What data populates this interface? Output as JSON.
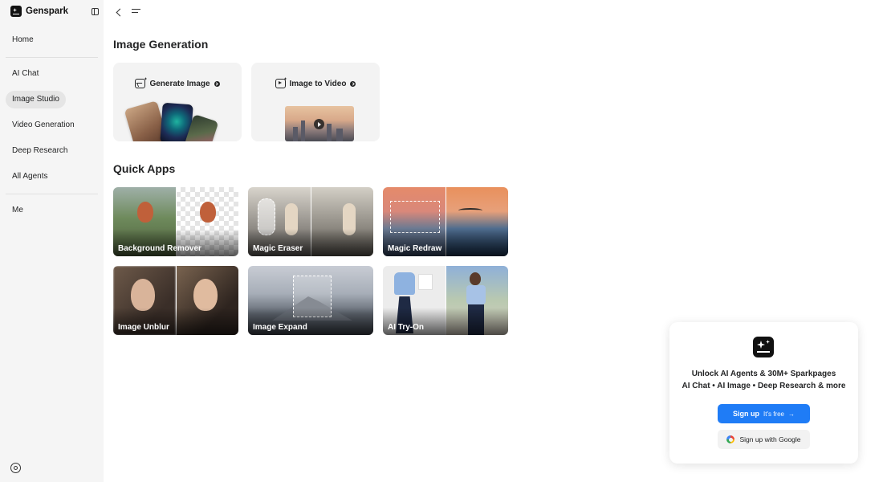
{
  "app": {
    "name": "Genspark"
  },
  "sidebar": {
    "items": [
      {
        "label": "Home"
      },
      {
        "label": "AI Chat"
      },
      {
        "label": "Image Studio"
      },
      {
        "label": "Video Generation"
      },
      {
        "label": "Deep Research"
      },
      {
        "label": "All Agents"
      },
      {
        "label": "Me"
      }
    ],
    "active": "Image Studio",
    "icons": {
      "logo": "genspark-logo-icon",
      "collapse": "sidebar-toggle-icon",
      "settings": "settings-icon"
    }
  },
  "topbar": {
    "icons": [
      "back-arrow-icon",
      "menu-icon"
    ]
  },
  "image_generation": {
    "title": "Image Generation",
    "cards": [
      {
        "label": "Generate Image",
        "icon": "image-sparkle-icon"
      },
      {
        "label": "Image to Video",
        "icon": "video-sparkle-icon"
      }
    ]
  },
  "quick_apps": {
    "title": "Quick Apps",
    "apps": [
      {
        "label": "Background Remover"
      },
      {
        "label": "Magic Eraser"
      },
      {
        "label": "Magic Redraw"
      },
      {
        "label": "Image Unblur"
      },
      {
        "label": "Image Expand"
      },
      {
        "label": "AI Try-On"
      }
    ]
  },
  "signup_panel": {
    "headline": "Unlock AI Agents & 30M+ Sparkpages",
    "subline": "AI Chat • AI Image • Deep Research & more",
    "signup_label": "Sign up",
    "signup_note": "It's free",
    "google_label": "Sign up with Google",
    "accent_color": "#1f7cf6"
  }
}
